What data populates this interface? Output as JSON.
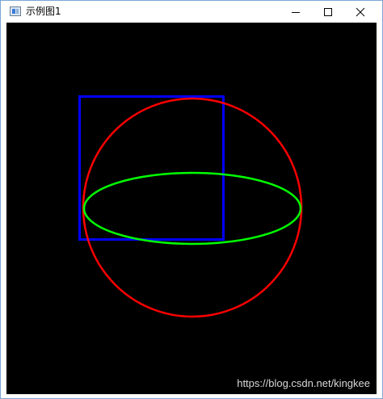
{
  "window": {
    "title": "示例图1",
    "icon": "app-window-icon",
    "controls": {
      "minimize_icon": "minimize-icon",
      "maximize_icon": "maximize-icon",
      "close_icon": "close-icon"
    }
  },
  "canvas": {
    "background": "#000000",
    "shapes": [
      {
        "type": "rectangle",
        "color": "#0000ff"
      },
      {
        "type": "circle",
        "color": "#ff0000"
      },
      {
        "type": "ellipse",
        "color": "#00ff00"
      }
    ]
  },
  "watermark": "https://blog.csdn.net/kingkee"
}
